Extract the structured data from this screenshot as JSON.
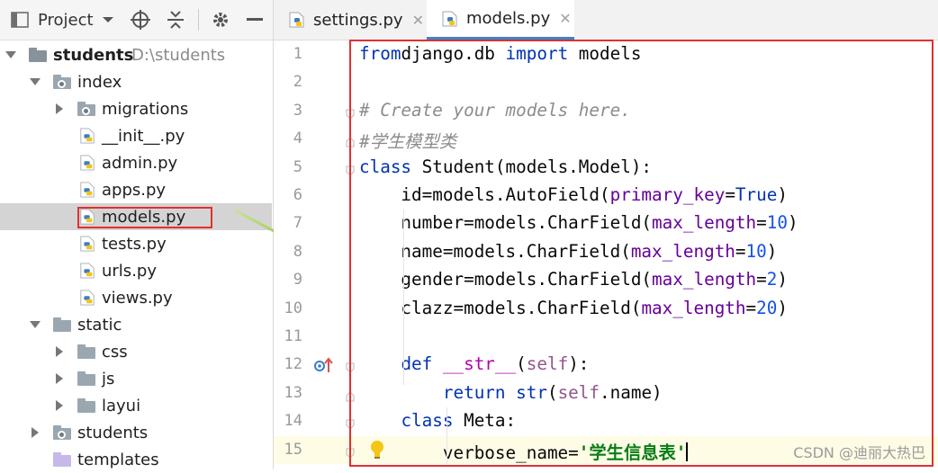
{
  "project": {
    "title": "Project",
    "tree": [
      {
        "label": "students",
        "suffix": "D:\\students",
        "kind": "folder-dark",
        "expanded": true,
        "indent": 0
      },
      {
        "label": "index",
        "kind": "folder-module",
        "expanded": true,
        "indent": 1
      },
      {
        "label": "migrations",
        "kind": "folder-module",
        "expanded": false,
        "indent": 2
      },
      {
        "label": "__init__.py",
        "kind": "python",
        "indent": 2
      },
      {
        "label": "admin.py",
        "kind": "python",
        "indent": 2
      },
      {
        "label": "apps.py",
        "kind": "python",
        "indent": 2
      },
      {
        "label": "models.py",
        "kind": "python",
        "indent": 2,
        "selected": true
      },
      {
        "label": "tests.py",
        "kind": "python",
        "indent": 2
      },
      {
        "label": "urls.py",
        "kind": "python",
        "indent": 2
      },
      {
        "label": "views.py",
        "kind": "python",
        "indent": 2
      },
      {
        "label": "static",
        "kind": "folder",
        "expanded": true,
        "indent": 1
      },
      {
        "label": "css",
        "kind": "folder",
        "expanded": false,
        "indent": 2
      },
      {
        "label": "js",
        "kind": "folder",
        "expanded": false,
        "indent": 2
      },
      {
        "label": "layui",
        "kind": "folder",
        "expanded": false,
        "indent": 2
      },
      {
        "label": "students",
        "kind": "folder-module",
        "expanded": false,
        "indent": 1
      },
      {
        "label": "templates",
        "kind": "folder-purple",
        "indent": 1
      }
    ]
  },
  "tabs": [
    {
      "label": "settings.py",
      "active": false
    },
    {
      "label": "models.py",
      "active": true
    }
  ],
  "editor": {
    "current_line": 15,
    "lines": [
      {
        "n": "1",
        "tokens": [
          [
            "kw",
            "from"
          ],
          [
            "",
            "django.db "
          ],
          [
            "kw",
            "import"
          ],
          [
            "",
            " models"
          ]
        ]
      },
      {
        "n": "2",
        "tokens": []
      },
      {
        "n": "3",
        "tokens": [
          [
            "cm",
            "# Create your models here."
          ]
        ]
      },
      {
        "n": "4",
        "tokens": [
          [
            "cm",
            "#学生模型类"
          ]
        ]
      },
      {
        "n": "5",
        "tokens": [
          [
            "kw",
            "class"
          ],
          [
            "",
            " Student(models.Model):"
          ]
        ]
      },
      {
        "n": "6",
        "tokens": [
          [
            "",
            "    id=models.AutoField("
          ],
          [
            "prm",
            "primary_key"
          ],
          [
            "",
            "="
          ],
          [
            "kw",
            "True"
          ],
          [
            "",
            ")"
          ]
        ]
      },
      {
        "n": "7",
        "tokens": [
          [
            "",
            "    number=models.CharField("
          ],
          [
            "prm",
            "max_length"
          ],
          [
            "",
            "="
          ],
          [
            "num",
            "10"
          ],
          [
            "",
            ")"
          ]
        ]
      },
      {
        "n": "8",
        "tokens": [
          [
            "",
            "    name=models.CharField("
          ],
          [
            "prm",
            "max_length"
          ],
          [
            "",
            "="
          ],
          [
            "num",
            "10"
          ],
          [
            "",
            ")"
          ]
        ]
      },
      {
        "n": "9",
        "tokens": [
          [
            "",
            "    gender=models.CharField("
          ],
          [
            "prm",
            "max_length"
          ],
          [
            "",
            "="
          ],
          [
            "num",
            "2"
          ],
          [
            "",
            ")"
          ]
        ]
      },
      {
        "n": "10",
        "tokens": [
          [
            "",
            "    clazz=models.CharField("
          ],
          [
            "prm",
            "max_length"
          ],
          [
            "",
            "="
          ],
          [
            "num",
            "20"
          ],
          [
            "",
            ")"
          ]
        ]
      },
      {
        "n": "11",
        "tokens": []
      },
      {
        "n": "12",
        "tokens": [
          [
            "",
            "    "
          ],
          [
            "kw",
            "def"
          ],
          [
            "",
            " "
          ],
          [
            "dnd",
            "__str__"
          ],
          [
            "",
            "("
          ],
          [
            "slf",
            "self"
          ],
          [
            "",
            "):"
          ]
        ]
      },
      {
        "n": "13",
        "tokens": [
          [
            "",
            "        "
          ],
          [
            "kw",
            "return"
          ],
          [
            "",
            " "
          ],
          [
            "kw",
            "str"
          ],
          [
            "",
            "("
          ],
          [
            "slf",
            "self"
          ],
          [
            "",
            ".name)"
          ]
        ]
      },
      {
        "n": "14",
        "tokens": [
          [
            "",
            "    "
          ],
          [
            "kw",
            "class"
          ],
          [
            "",
            " Meta:"
          ]
        ]
      },
      {
        "n": "15",
        "tokens": [
          [
            "",
            "        verbose_name="
          ],
          [
            "str",
            "'学生信息表'"
          ]
        ]
      }
    ]
  },
  "watermark": "CSDN @迪丽大热巴",
  "colors": {
    "highlight_red": "#e03030",
    "arrow_green": "#8dc21f",
    "tab_accent": "#4083c9"
  }
}
